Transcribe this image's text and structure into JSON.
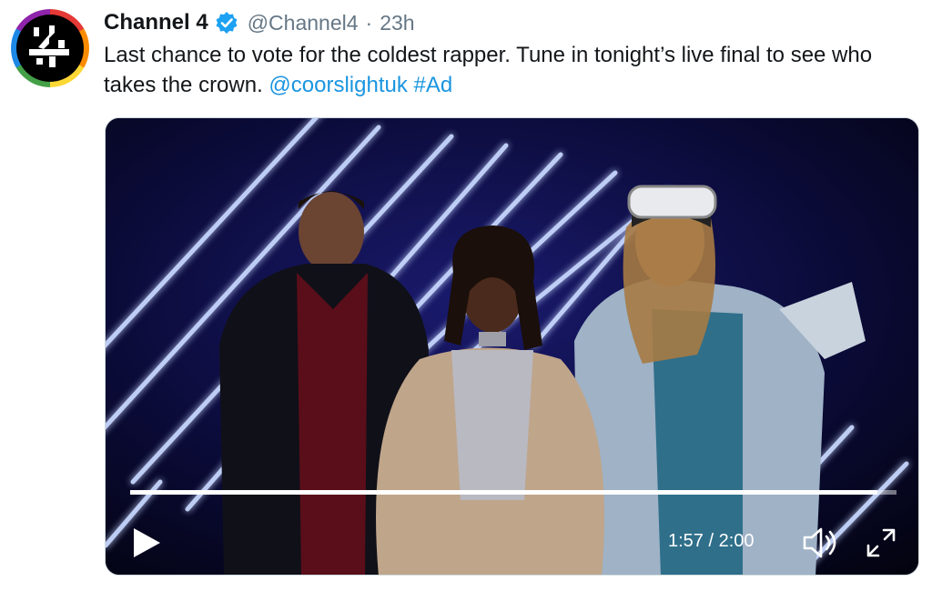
{
  "tweet": {
    "author_name": "Channel 4",
    "handle": "@Channel4",
    "separator": "·",
    "time": "23h",
    "avatar_icon": "channel4-logo-icon",
    "verified_icon": "verified-badge-icon",
    "text_main": "Last chance to vote for the coldest rapper. Tune in tonight’s live final to see who takes the crown. ",
    "mention": "@coorslightuk",
    "hashtag": "#Ad"
  },
  "video": {
    "current_time": "1:57",
    "duration": "2:00",
    "time_separator": " / ",
    "progress_fraction": 0.975,
    "play_icon": "play-icon",
    "volume_icon": "volume-icon",
    "fullscreen_icon": "fullscreen-icon"
  },
  "colors": {
    "link": "#1b95e0",
    "verified": "#1da1f2",
    "text": "#14171a",
    "muted": "#657786"
  }
}
